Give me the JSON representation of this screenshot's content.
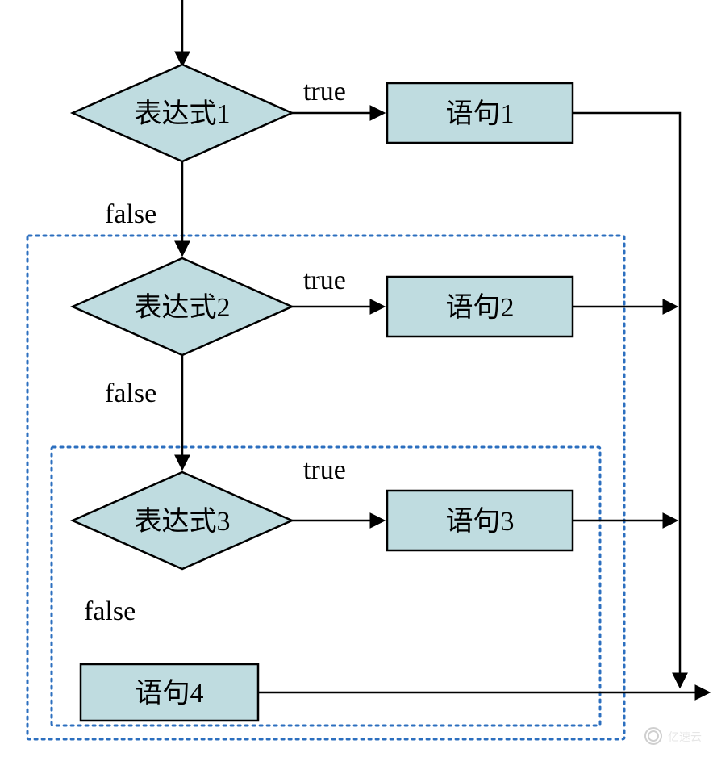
{
  "diagram": {
    "type": "flowchart",
    "title": "",
    "expressions": {
      "expr1": "表达式1",
      "expr2": "表达式2",
      "expr3": "表达式3"
    },
    "statements": {
      "stmt1": "语句1",
      "stmt2": "语句2",
      "stmt3": "语句3",
      "stmt4": "语句4"
    },
    "edge_labels": {
      "true": "true",
      "false": "false"
    },
    "nesting": [
      {
        "box": "outer",
        "contains": [
          "expr2",
          "expr3",
          "stmt4"
        ]
      },
      {
        "box": "inner",
        "contains": [
          "expr3",
          "stmt4"
        ]
      }
    ],
    "colors": {
      "node_fill": "#bfdce0",
      "node_stroke": "#000000",
      "dotted_box": "#2c6fbf"
    },
    "watermark": "亿速云"
  }
}
